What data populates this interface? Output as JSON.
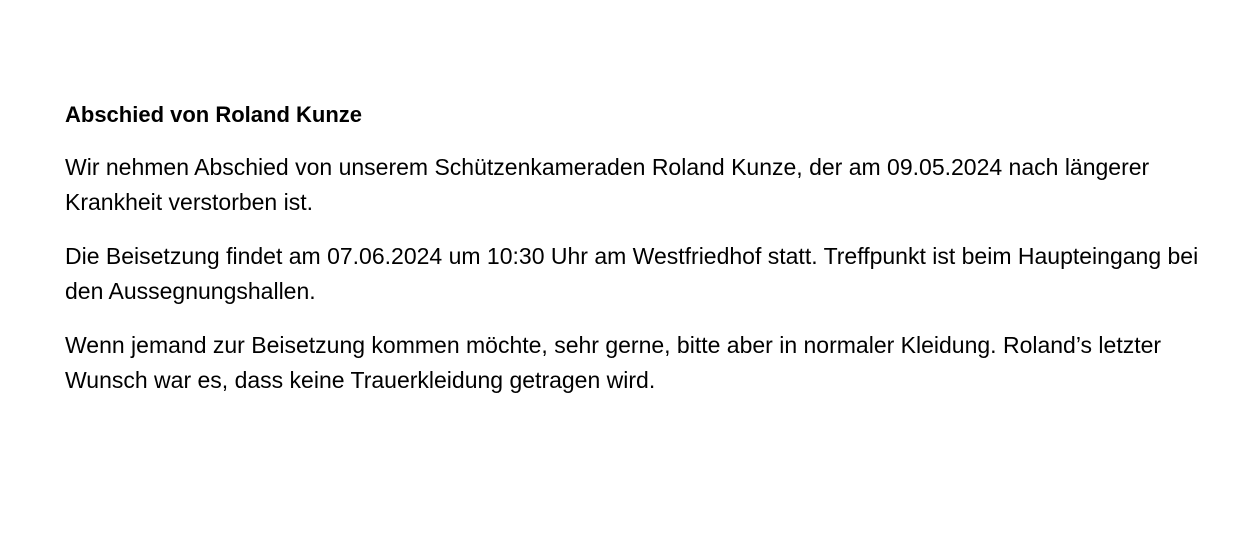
{
  "document": {
    "title": "Abschied von Roland Kunze",
    "paragraphs": [
      "Wir nehmen Abschied von unserem Schützenkameraden Roland Kunze, der am 09.05.2024 nach längerer Krankheit verstorben ist.",
      "Die Beisetzung findet am 07.06.2024 um 10:30 Uhr am Westfriedhof statt. Treffpunkt ist beim Haupteingang bei den Aussegnungshallen.",
      "Wenn jemand zur Beisetzung kommen möchte, sehr gerne, bitte aber in normaler Kleidung. Roland’s letzter Wunsch war es, dass keine Trauerkleidung getragen wird."
    ]
  }
}
